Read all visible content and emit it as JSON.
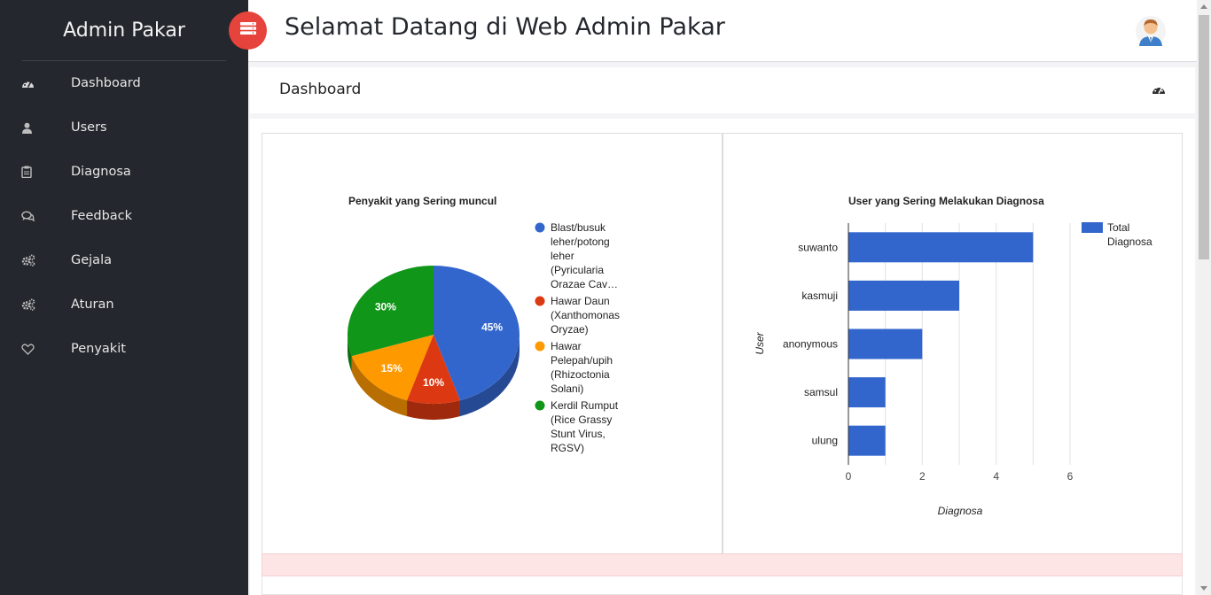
{
  "sidebar": {
    "brand": "Admin Pakar",
    "items": [
      {
        "label": "Dashboard",
        "icon": "dashboard-icon"
      },
      {
        "label": "Users",
        "icon": "user-icon"
      },
      {
        "label": "Diagnosa",
        "icon": "clipboard-icon"
      },
      {
        "label": "Feedback",
        "icon": "comments-icon"
      },
      {
        "label": "Gejala",
        "icon": "cogs-icon"
      },
      {
        "label": "Aturan",
        "icon": "cogs-icon"
      },
      {
        "label": "Penyakit",
        "icon": "heart-icon"
      }
    ]
  },
  "topbar": {
    "title": "Selamat Datang di Web Admin Pakar",
    "toggle_icon": "server-icon",
    "avatar_icon": "user-avatar-icon"
  },
  "page": {
    "title": "Dashboard",
    "icon": "dashboard-icon"
  },
  "colors": {
    "sidebar_bg": "#24272d",
    "accent_red": "#e5433b",
    "blue": "#3366cc",
    "red": "#dc3912",
    "orange": "#ff9900",
    "green": "#109618",
    "alert_bg": "#fde5e6"
  },
  "chart_data": [
    {
      "type": "pie",
      "title": "Penyakit yang Sering muncul",
      "slices": [
        {
          "label": "Blast/busuk leher/potong leher (Pyricularia Orazae Cav…",
          "legend_lines": [
            "Blast/busuk",
            "leher/potong",
            "leher",
            "(Pyricularia",
            "Orazae Cav…"
          ],
          "percent_label": "45%",
          "value": 45,
          "color": "#3366cc"
        },
        {
          "label": "Hawar Daun (Xanthomonas Oryzae)",
          "legend_lines": [
            "Hawar Daun",
            "(Xanthomonas",
            "Oryzae)"
          ],
          "percent_label": "10%",
          "value": 10,
          "color": "#dc3912"
        },
        {
          "label": "Hawar Pelepah/upih (Rhizoctonia Solani)",
          "legend_lines": [
            "Hawar",
            "Pelepah/upih",
            "(Rhizoctonia",
            "Solani)"
          ],
          "percent_label": "15%",
          "value": 15,
          "color": "#ff9900"
        },
        {
          "label": "Kerdil Rumput (Rice Grassy Stunt Virus, RGSV)",
          "legend_lines": [
            "Kerdil Rumput",
            "(Rice Grassy",
            "Stunt Virus,",
            "RGSV)"
          ],
          "percent_label": "30%",
          "value": 30,
          "color": "#109618"
        }
      ],
      "legend_position": "right",
      "style": "3d"
    },
    {
      "type": "bar",
      "orientation": "horizontal",
      "title": "User yang Sering Melakukan Diagnosa",
      "categories": [
        "suwanto",
        "kasmuji",
        "anonymous",
        "samsul",
        "ulung"
      ],
      "series": [
        {
          "name": "Total Diagnosa",
          "legend_lines": [
            "Total",
            "Diagnosa"
          ],
          "values": [
            5,
            3,
            2,
            1,
            1
          ],
          "color": "#3366cc"
        }
      ],
      "xlabel": "Diagnosa",
      "ylabel": "User",
      "xlim": [
        0,
        6
      ],
      "xticks": [
        "0",
        "2",
        "4",
        "6"
      ],
      "grid": true,
      "legend_position": "right"
    }
  ]
}
